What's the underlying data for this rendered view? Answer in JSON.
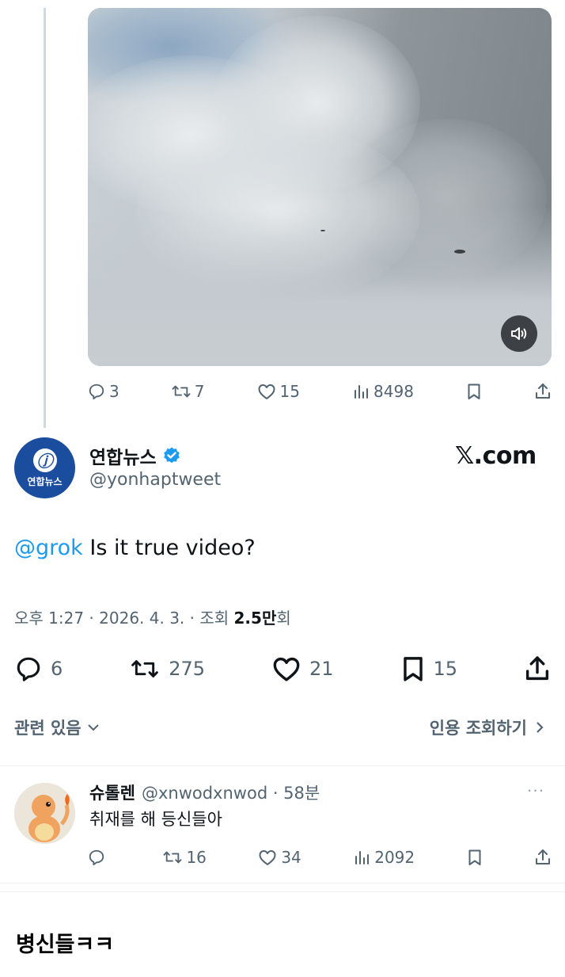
{
  "quoted_tweet": {
    "stats": {
      "replies": "3",
      "reposts": "7",
      "likes": "15",
      "views": "8498"
    }
  },
  "main_tweet": {
    "author_name": "연합뉴스",
    "avatar_text": "연합뉴스",
    "handle": "@yonhaptweet",
    "watermark": "𝕏.com",
    "mention": "@grok",
    "text": " Is it true video?",
    "timestamp": "오후 1:27 · 2026. 4. 3. · 조회 ",
    "views_number": "2.5만",
    "views_suffix": "회",
    "stats": {
      "replies": "6",
      "reposts": "275",
      "likes": "21",
      "bookmarks": "15"
    },
    "related_label": "관련 있음",
    "quote_link_label": "인용 조회하기"
  },
  "reply": {
    "author_name": "슈톨렌",
    "handle_time": "@xnwodxnwod · 58분",
    "more": "···",
    "text": "취재를 해 등신들아",
    "stats": {
      "reposts": "16",
      "likes": "34",
      "views": "2092"
    }
  },
  "footer_comment": "병신들ㅋㅋ",
  "colors": {
    "accent": "#1d9bf0",
    "muted": "#536471",
    "text": "#0f1419",
    "verified": "#1d9bf0"
  }
}
